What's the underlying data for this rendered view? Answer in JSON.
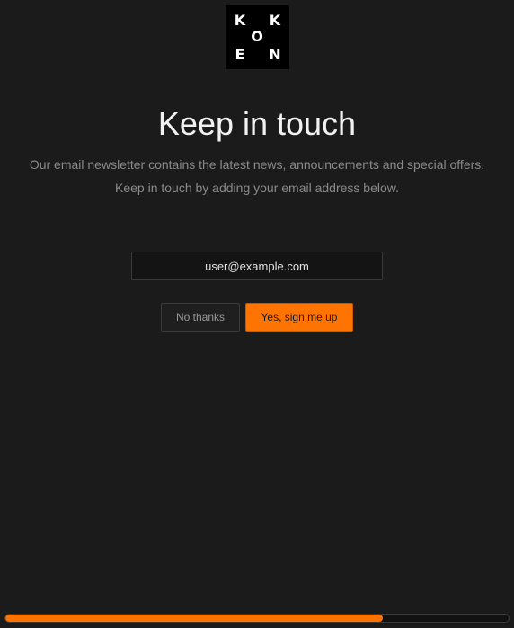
{
  "logo": {
    "letters": [
      "K",
      "K",
      "O",
      "E",
      "N"
    ]
  },
  "title": "Keep in touch",
  "description": {
    "line1": "Our email newsletter contains the latest news, announcements and special offers.",
    "line2": "Keep in touch by adding your email address below."
  },
  "email_input": {
    "value": "user@example.com",
    "placeholder": ""
  },
  "buttons": {
    "no_label": "No thanks",
    "yes_label": "Yes, sign me up"
  },
  "progress": {
    "fraction": 0.75
  },
  "colors": {
    "background": "#1b1b1b",
    "accent": "#ff7400",
    "text_primary": "#f2f2f2",
    "text_muted": "#8a8a8a"
  }
}
